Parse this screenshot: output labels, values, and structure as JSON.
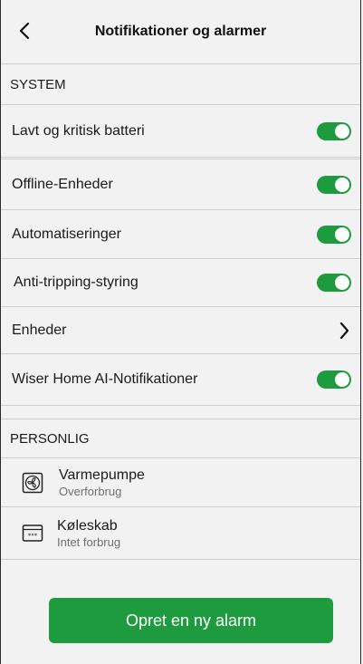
{
  "header": {
    "title": "Notifikationer og alarmer",
    "back_icon": "chevron-left-icon"
  },
  "system": {
    "section_label": "SYSTEM",
    "rows": [
      {
        "label": "Lavt og kritisk batteri",
        "control": "toggle",
        "on": true
      },
      {
        "label": "Offline-Enheder",
        "control": "toggle",
        "on": true
      },
      {
        "label": "Automatiseringer",
        "control": "toggle",
        "on": true
      },
      {
        "label": "Anti-tripping-styring",
        "control": "toggle",
        "on": true
      },
      {
        "label": "Enheder",
        "control": "chevron"
      },
      {
        "label": "Wiser Home AI-Notifikationer",
        "control": "toggle",
        "on": true
      }
    ]
  },
  "personlig": {
    "section_label": "PERSONLIG",
    "items": [
      {
        "title": "Varmepumpe",
        "subtitle": "Overforbrug",
        "icon": "heat-pump-icon"
      },
      {
        "title": "Køleskab",
        "subtitle": "Intet forbrug",
        "icon": "fridge-icon"
      }
    ]
  },
  "actions": {
    "create_alarm_label": "Opret en ny alarm"
  },
  "colors": {
    "accent": "#1e9b3e",
    "background": "#f2f2f2",
    "divider": "#cfcfcf"
  }
}
